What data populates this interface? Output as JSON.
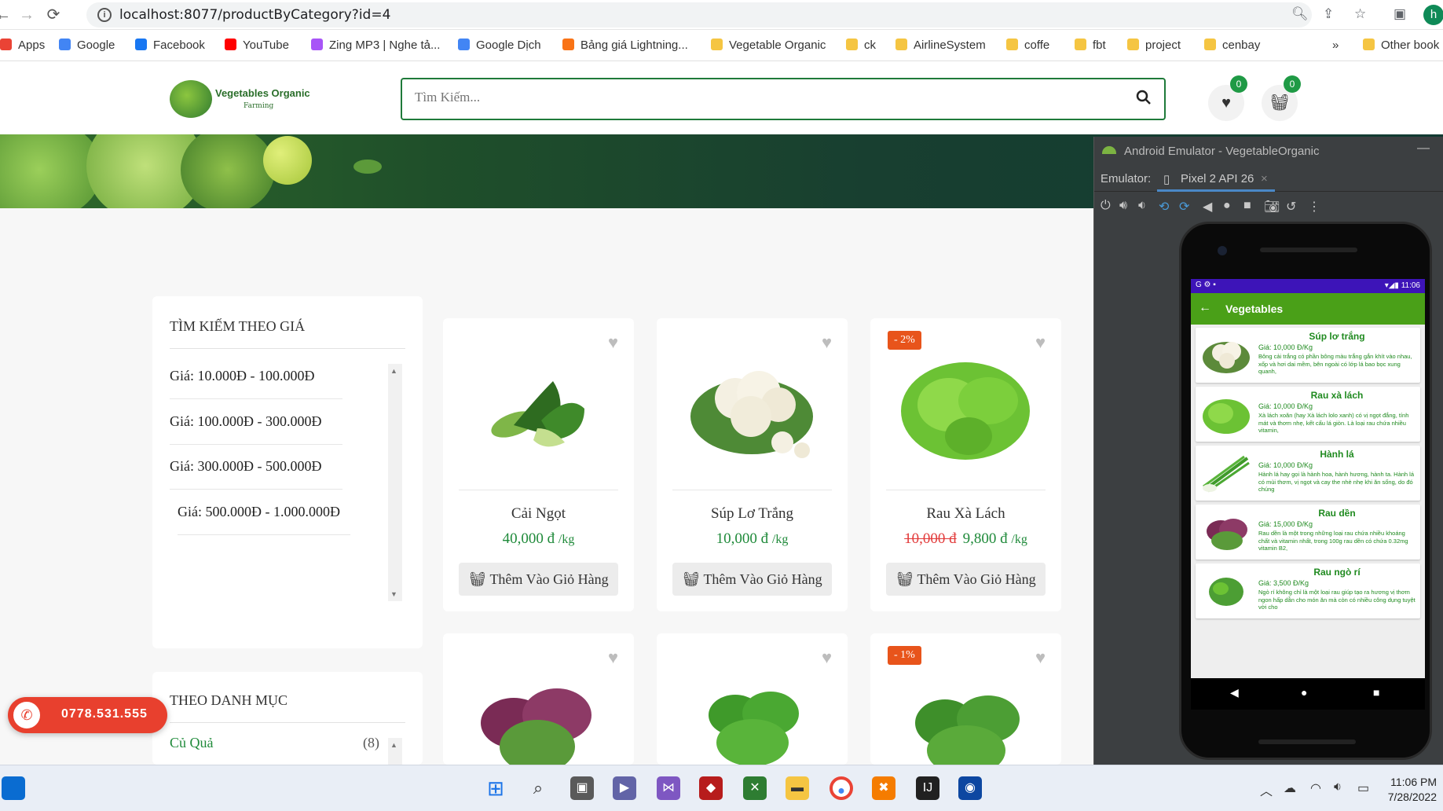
{
  "browser": {
    "url": "localhost:8077/productByCategory?id=4",
    "bookmarks": [
      {
        "label": "Apps",
        "color": "#ea4335"
      },
      {
        "label": "Google",
        "color": "#4285f4"
      },
      {
        "label": "Facebook",
        "color": "#1877f2"
      },
      {
        "label": "YouTube",
        "color": "#ff0000"
      },
      {
        "label": "Zing MP3 | Nghe tả...",
        "color": "#a855f7"
      },
      {
        "label": "Google Dịch",
        "color": "#4285f4"
      },
      {
        "label": "Bảng giá Lightning...",
        "color": "#f97316"
      },
      {
        "label": "Vegetable Organic",
        "color": "#f5c542"
      },
      {
        "label": "ck",
        "color": "#f5c542"
      },
      {
        "label": "AirlineSystem",
        "color": "#f5c542"
      },
      {
        "label": "coffe",
        "color": "#f5c542"
      },
      {
        "label": "fbt",
        "color": "#f5c542"
      },
      {
        "label": "project",
        "color": "#f5c542"
      },
      {
        "label": "cenbay",
        "color": "#f5c542"
      },
      {
        "label": "»",
        "color": ""
      },
      {
        "label": "Other book",
        "color": "#f5c542"
      }
    ],
    "profile_initial": "h"
  },
  "site": {
    "logo_title": "Vegetables Organic",
    "logo_sub": "Farming",
    "search_placeholder": "Tìm Kiếm...",
    "wishlist_count": "0",
    "cart_count": "0"
  },
  "sidebar": {
    "price_title": "TÌM KIẾM THEO GIÁ",
    "price_ranges": [
      "Giá: 10.000Đ - 100.000Đ",
      "Giá: 100.000Đ - 300.000Đ",
      "Giá: 300.000Đ - 500.000Đ",
      "Giá: 500.000Đ - 1.000.000Đ"
    ],
    "category_title": "THEO DANH MỤC",
    "categories": [
      {
        "name": "Củ Quả",
        "count": "(8)"
      }
    ]
  },
  "products": [
    {
      "name": "Cải Ngọt",
      "old_price": "",
      "price": "40,000 đ",
      "unit": "/kg",
      "badge": "",
      "button": "Thêm Vào Giỏ Hàng"
    },
    {
      "name": "Súp Lơ Trắng",
      "old_price": "",
      "price": "10,000 đ",
      "unit": "/kg",
      "badge": "",
      "button": "Thêm Vào Giỏ Hàng"
    },
    {
      "name": "Rau Xà Lách",
      "old_price": "10,000 đ",
      "price": "9,800 đ",
      "unit": "/kg",
      "badge": "- 2%",
      "button": "Thêm Vào Giỏ Hàng"
    },
    {
      "name": "",
      "old_price": "",
      "price": "",
      "unit": "",
      "badge": "",
      "button": ""
    },
    {
      "name": "",
      "old_price": "",
      "price": "",
      "unit": "",
      "badge": "",
      "button": ""
    },
    {
      "name": "",
      "old_price": "",
      "price": "",
      "unit": "",
      "badge": "- 1%",
      "button": ""
    }
  ],
  "hotline": "0778.531.555",
  "emulator": {
    "window_title": "Android Emulator - VegetableOrganic",
    "label": "Emulator:",
    "device_tab": "Pixel 2 API 26",
    "status_time": "11:06",
    "app_title": "Vegetables",
    "items": [
      {
        "name": "Súp lơ trắng",
        "price": "Giá: 10,000 Đ/Kg",
        "desc": "Bông cải trắng có phần bông màu trắng gắn khít vào nhau, xốp và hơi dai mềm, bên ngoài có lớp lá bao bọc xung quanh,"
      },
      {
        "name": "Rau xà lách",
        "price": "Giá: 10,000 Đ/Kg",
        "desc": "Xà lách xoăn (hay Xà lách lolo xanh) có vị ngọt đắng, tính mát và thơm nhẹ, kết cấu lá giòn. Là loại rau chứa nhiều vitamin,"
      },
      {
        "name": "Hành lá",
        "price": "Giá: 10,000 Đ/Kg",
        "desc": "Hành lá hay gọi là hành hoa, hành hương, hành ta. Hành lá có mùi thơm, vị ngọt và cay the nhè nhẹ khi ăn sống, do đó chúng"
      },
      {
        "name": "Rau dền",
        "price": "Giá: 15,000 Đ/Kg",
        "desc": "Rau dền là một trong những loại rau chứa nhiều khoáng chất và vitamin nhất, trong 100g rau dền có chứa 0.32mg vitamin B2,"
      },
      {
        "name": "Rau ngò rí",
        "price": "Giá: 3,500 Đ/Kg",
        "desc": "Ngò rí không chỉ là một loại rau giúp tạo ra hương vị thơm ngon hấp dẫn cho món ăn mà còn có nhiều công dụng tuyệt vời cho"
      }
    ]
  },
  "taskbar": {
    "time": "11:06 PM",
    "date": "7/28/2022"
  }
}
